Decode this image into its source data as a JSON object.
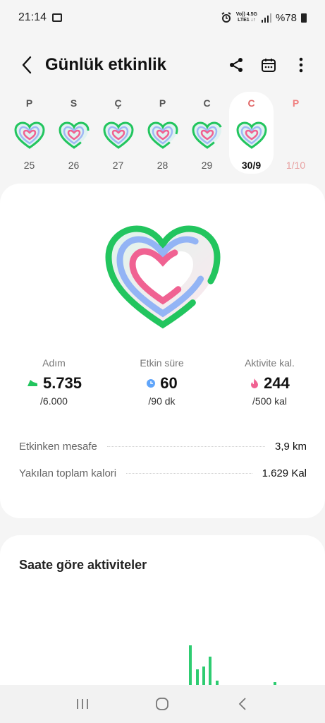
{
  "status_bar": {
    "time": "21:14",
    "net_top": "Vo)) 4.5G",
    "net_bottom": "LTE1 ↓↑",
    "battery": "%78"
  },
  "header": {
    "title": "Günlük etkinlik"
  },
  "week": [
    {
      "name": "P",
      "num": "25"
    },
    {
      "name": "S",
      "num": "26"
    },
    {
      "name": "Ç",
      "num": "27"
    },
    {
      "name": "P",
      "num": "28"
    },
    {
      "name": "C",
      "num": "29"
    },
    {
      "name": "C",
      "num": "30/9"
    },
    {
      "name": "P",
      "num": "1/10"
    }
  ],
  "stats": {
    "steps": {
      "label": "Adım",
      "value": "5.735",
      "goal": "/6.000"
    },
    "active_time": {
      "label": "Etkin süre",
      "value": "60",
      "goal": "/90 dk"
    },
    "activity_cal": {
      "label": "Aktivite kal.",
      "value": "244",
      "goal": "/500 kal"
    }
  },
  "details": {
    "distance": {
      "label": "Etkinken mesafe",
      "value": "3,9 km"
    },
    "total_cal": {
      "label": "Yakılan toplam kalori",
      "value": "1.629 Kal"
    }
  },
  "hourly": {
    "title": "Saate göre aktiviteler"
  },
  "colors": {
    "green": "#22c55e",
    "blue": "#60a5fa",
    "pink": "#f06292",
    "accent_red": "#e06666"
  }
}
